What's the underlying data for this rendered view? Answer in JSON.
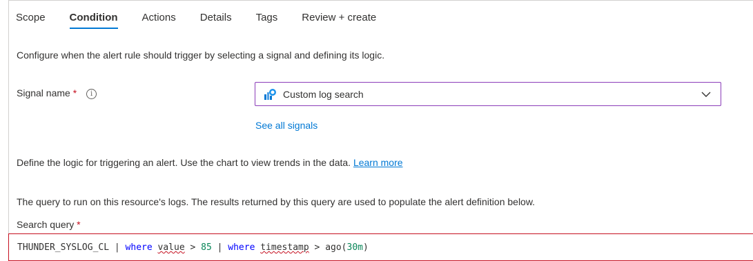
{
  "tabs": [
    {
      "label": "Scope",
      "active": false
    },
    {
      "label": "Condition",
      "active": true
    },
    {
      "label": "Actions",
      "active": false
    },
    {
      "label": "Details",
      "active": false
    },
    {
      "label": "Tags",
      "active": false
    },
    {
      "label": "Review + create",
      "active": false
    }
  ],
  "condition": {
    "description": "Configure when the alert rule should trigger by selecting a signal and defining its logic.",
    "signal_label": "Signal name",
    "required_marker": "*",
    "info_icon_glyph": "i",
    "signal_value": "Custom log search",
    "signal_icon": "log-search-icon",
    "see_all_signals": "See all signals",
    "logic_text": "Define the logic for triggering an alert. Use the chart to view trends in the data.",
    "learn_more": "Learn more",
    "query_description": "The query to run on this resource's logs. The results returned by this query are used to populate the alert definition below.",
    "search_query_label": "Search query",
    "query": {
      "table": "THUNDER_SYSLOG_CL",
      "pipe1": " | ",
      "kw_where1": "where",
      "field_value": "value",
      "op_gt1": " > ",
      "number": "85",
      "pipe2": " | ",
      "kw_where2": "where",
      "field_timestamp": "timestamp",
      "op_gt2": " > ",
      "func": "ago(",
      "duration": "30m",
      "close": ")"
    }
  },
  "colors": {
    "accent": "#0078d4",
    "required": "#c50f1f",
    "dropdown_border": "#8a3bb8",
    "keyword": "#0000ff",
    "number": "#098658"
  }
}
